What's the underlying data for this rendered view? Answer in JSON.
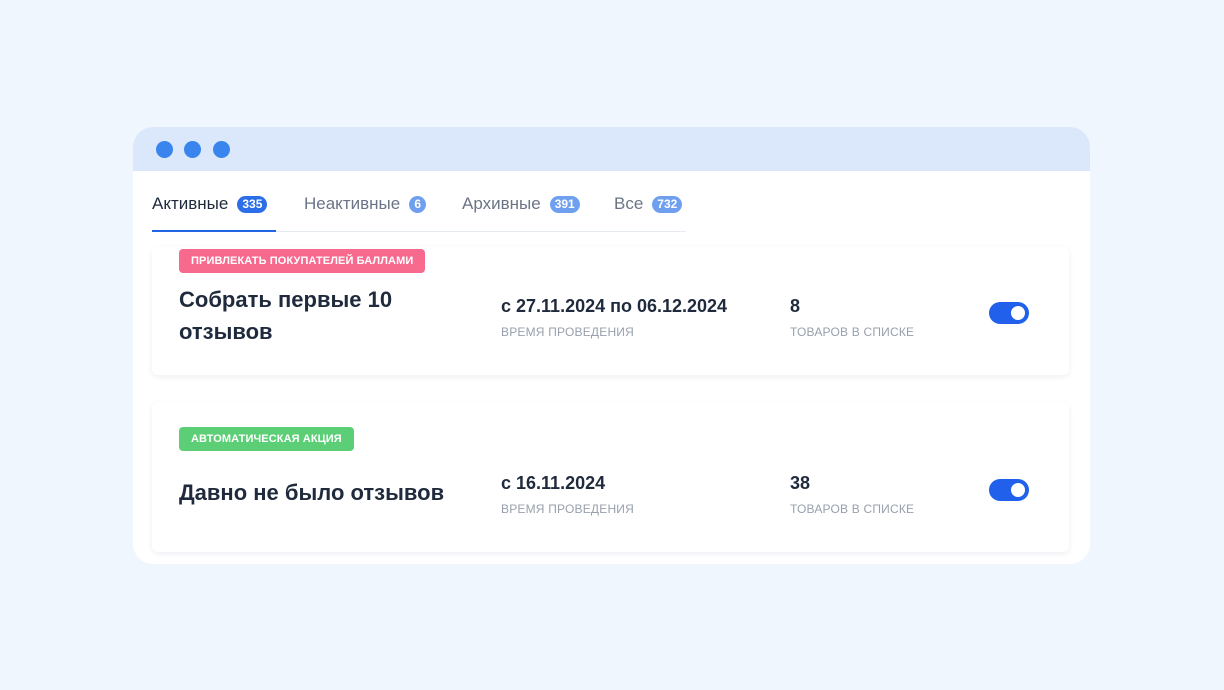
{
  "colors": {
    "accent": "#2266e5",
    "tag_pink": "#f7698d",
    "tag_green": "#5ccf76",
    "titlebar": "#dbe8fb"
  },
  "tabs": [
    {
      "label": "Активные",
      "count": "335",
      "active": true
    },
    {
      "label": "Неактивные",
      "count": "6",
      "active": false
    },
    {
      "label": "Архивные",
      "count": "391",
      "active": false
    },
    {
      "label": "Все",
      "count": "732",
      "active": false
    }
  ],
  "promotions": [
    {
      "tag": "ПРИВЛЕКАТЬ ПОКУПАТЕЛЕЙ БАЛЛАМИ",
      "title": "Собрать первые 10 отзывов",
      "period": "с 27.11.2024 по 06.12.2024",
      "period_caption": "ВРЕМЯ ПРОВЕДЕНИЯ",
      "items_count": "8",
      "items_caption": "ТОВАРОВ В СПИСКЕ",
      "enabled": true
    },
    {
      "tag": "АВТОМАТИЧЕСКАЯ АКЦИЯ",
      "title": "Давно не было отзывов",
      "period": "с 16.11.2024",
      "period_caption": "ВРЕМЯ ПРОВЕДЕНИЯ",
      "items_count": "38",
      "items_caption": "ТОВАРОВ В СПИСКЕ",
      "enabled": true
    }
  ]
}
